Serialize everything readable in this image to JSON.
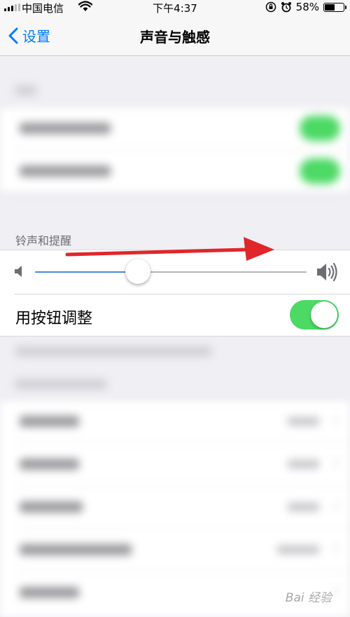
{
  "status_bar": {
    "carrier": "中国电信",
    "time": "下午4:37",
    "battery_percent": "58%",
    "battery_level": 0.58
  },
  "nav": {
    "back_label": "设置",
    "title": "声音与触感"
  },
  "ringer": {
    "section_header": "铃声和提醒",
    "volume_level": 0.38,
    "toggle_label": "用按钮调整",
    "toggle_on": true
  },
  "watermark": "Bai 经验",
  "colors": {
    "accent": "#007aff",
    "switch_on": "#4cd964",
    "arrow": "#e0262b",
    "slider_fill": "#4a8ae0"
  }
}
